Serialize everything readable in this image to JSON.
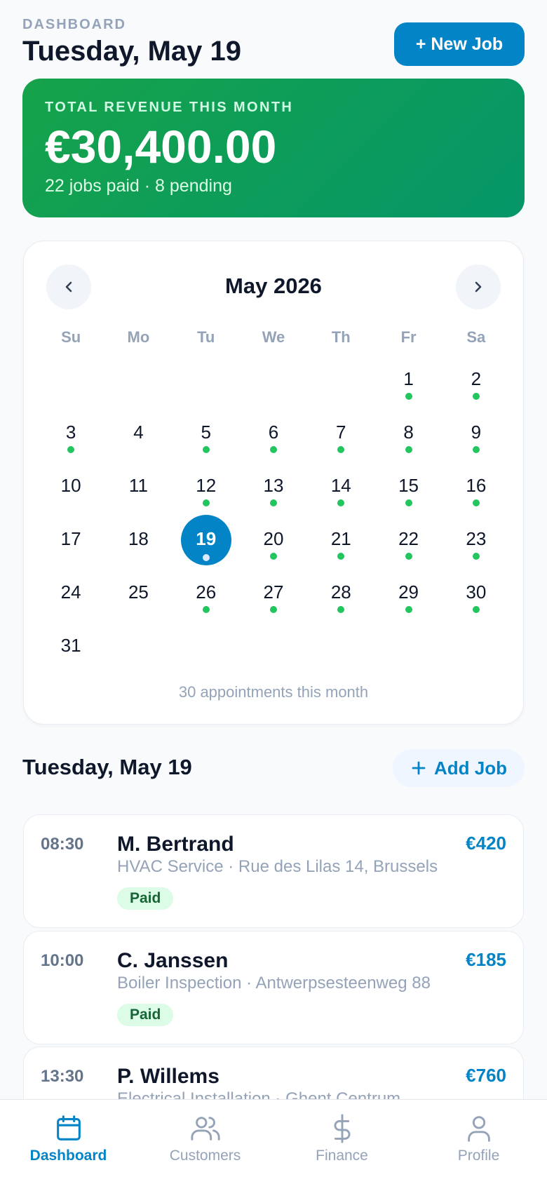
{
  "header": {
    "eyebrow": "DASHBOARD",
    "title": "Tuesday, May 19",
    "new_job_label": "+ New Job"
  },
  "revenue": {
    "label": "TOTAL REVENUE THIS MONTH",
    "amount": "€30,400.00",
    "summary": "22 jobs paid · 8 pending"
  },
  "calendar": {
    "month_label": "May 2026",
    "weekdays": [
      "Su",
      "Mo",
      "Tu",
      "We",
      "Th",
      "Fr",
      "Sa"
    ],
    "leading_blanks": 5,
    "days": [
      {
        "n": "1",
        "dot": true
      },
      {
        "n": "2",
        "dot": true
      },
      {
        "n": "3",
        "dot": true
      },
      {
        "n": "4",
        "dot": false
      },
      {
        "n": "5",
        "dot": true
      },
      {
        "n": "6",
        "dot": true
      },
      {
        "n": "7",
        "dot": true
      },
      {
        "n": "8",
        "dot": true
      },
      {
        "n": "9",
        "dot": true
      },
      {
        "n": "10",
        "dot": false
      },
      {
        "n": "11",
        "dot": false
      },
      {
        "n": "12",
        "dot": true
      },
      {
        "n": "13",
        "dot": true
      },
      {
        "n": "14",
        "dot": true
      },
      {
        "n": "15",
        "dot": true
      },
      {
        "n": "16",
        "dot": true
      },
      {
        "n": "17",
        "dot": false
      },
      {
        "n": "18",
        "dot": false
      },
      {
        "n": "19",
        "dot": true,
        "selected": true
      },
      {
        "n": "20",
        "dot": true
      },
      {
        "n": "21",
        "dot": true
      },
      {
        "n": "22",
        "dot": true
      },
      {
        "n": "23",
        "dot": true
      },
      {
        "n": "24",
        "dot": false
      },
      {
        "n": "25",
        "dot": false
      },
      {
        "n": "26",
        "dot": true
      },
      {
        "n": "27",
        "dot": true
      },
      {
        "n": "28",
        "dot": true
      },
      {
        "n": "29",
        "dot": true
      },
      {
        "n": "30",
        "dot": true
      },
      {
        "n": "31",
        "dot": false
      }
    ],
    "footer": "30 appointments this month"
  },
  "schedule": {
    "title": "Tuesday, May 19",
    "add_job_label": "Add Job",
    "jobs": [
      {
        "time": "08:30",
        "name": "M. Bertrand",
        "desc": "HVAC Service · Rue des Lilas 14, Brussels",
        "price": "€420",
        "status": "Paid"
      },
      {
        "time": "10:00",
        "name": "C. Janssen",
        "desc": "Boiler Inspection · Antwerpsesteenweg 88",
        "price": "€185",
        "status": "Paid"
      },
      {
        "time": "13:30",
        "name": "P. Willems",
        "desc": "Electrical Installation · Ghent Centrum",
        "price": "€760",
        "status": ""
      }
    ]
  },
  "nav": {
    "items": [
      {
        "label": "Dashboard",
        "icon": "calendar-icon",
        "active": true
      },
      {
        "label": "Customers",
        "icon": "users-icon",
        "active": false
      },
      {
        "label": "Finance",
        "icon": "dollar-icon",
        "active": false
      },
      {
        "label": "Profile",
        "icon": "user-icon",
        "active": false
      }
    ]
  },
  "colors": {
    "primary": "#0284c7",
    "revenue_start": "#16a34a",
    "revenue_end": "#059669",
    "dot": "#22c55e",
    "badge_bg": "#dcfce7",
    "badge_text": "#166534"
  }
}
